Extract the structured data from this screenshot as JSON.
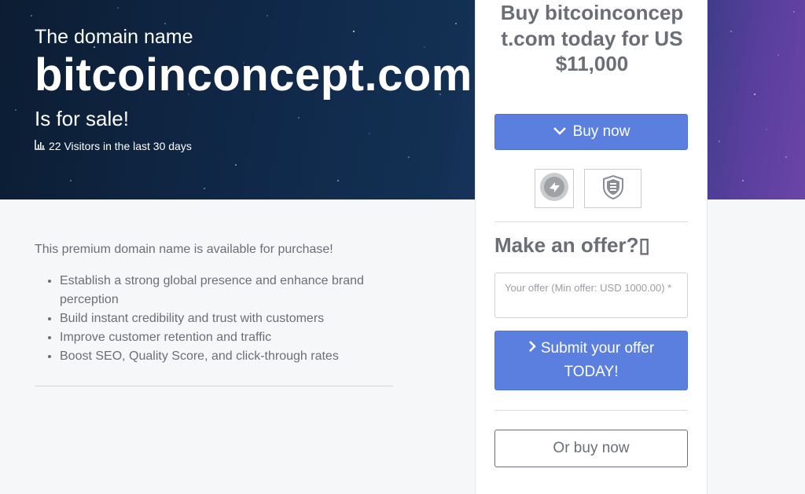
{
  "hero": {
    "intro": "The domain name",
    "domain": "bitcoinconcept.com",
    "for_sale": "Is for sale!",
    "visitors_text": "22 Visitors in the last 30 days"
  },
  "content": {
    "intro": "This premium domain name is available for purchase!",
    "bullets": [
      "Establish a strong global presence and enhance brand perception",
      "Build instant credibility and trust with customers",
      "Improve customer retention and traffic",
      "Boost SEO, Quality Score, and click-through rates"
    ]
  },
  "card": {
    "title": "Buy bitcoinconcept.com today for US$11,000",
    "buy_now_label": "Buy now",
    "offer_heading": "Make an offer?▯",
    "offer_placeholder": "Your offer (Min offer: USD 1000.00) *",
    "submit_label_line1": "Submit your offer",
    "submit_label_line2": "TODAY!",
    "or_buy_now_label": "Or buy now"
  },
  "icons": {
    "visitors": "bar-chart-icon",
    "buy_now": "chevron-down-icon",
    "submit": "chevron-right-icon",
    "trust_1": "transfer-badge-icon",
    "trust_2": "escrow-shield-icon"
  },
  "colors": {
    "primary": "#5b7fde",
    "text": "#6b6f75",
    "hero_bg": "#10294a"
  }
}
